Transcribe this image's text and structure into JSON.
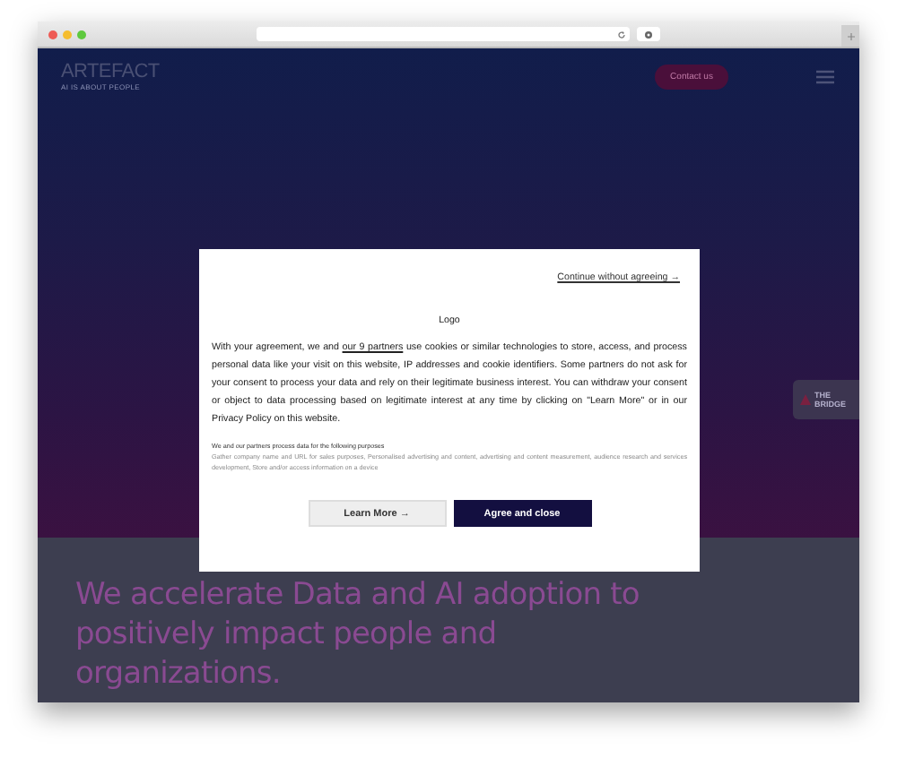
{
  "header": {
    "logo": "ARTEFACT",
    "tagline": "AI IS ABOUT PEOPLE",
    "contact_button": "Contact us"
  },
  "side_badge": {
    "text": "THE BRIDGE"
  },
  "hero": {
    "headline": "We accelerate Data and AI adoption to positively impact people and organizations."
  },
  "consent_dialog": {
    "skip_link": "Continue without agreeing →",
    "logo": "Logo",
    "body_before_link": "With your agreement, we and ",
    "partners_link": "our 9 partners",
    "body_after_link": " use cookies or similar technologies to store, access, and process personal data like your visit on this website, IP addresses and cookie identifiers. Some partners do not ask for your consent to process your data and rely on their legitimate business interest. You can withdraw your consent or object to data processing based on legitimate interest at any time by clicking on \"Learn More\" or in our Privacy Policy on this website.",
    "purposes_heading": "We and our partners process data for the following purposes",
    "purposes": "Gather company name and URL for sales purposes, Personalised advertising and content, advertising and content measurement, audience research and services development, Store and/or access information on a device",
    "buttons": [
      {
        "label": "Learn More →",
        "kind": "secondary"
      },
      {
        "label": "Agree and close",
        "kind": "primary"
      }
    ]
  }
}
